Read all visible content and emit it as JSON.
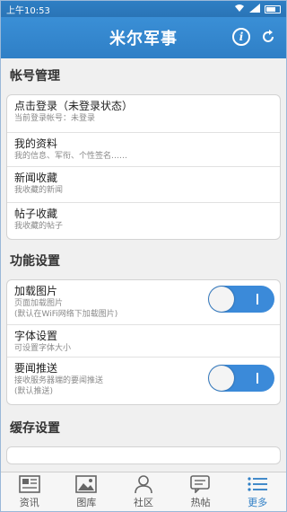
{
  "status_bar": {
    "time": "上午10:53"
  },
  "header": {
    "title": "米尔军事"
  },
  "sections": {
    "account": {
      "title": "帐号管理",
      "items": [
        {
          "title": "点击登录（未登录状态）",
          "subtitle": "当前登录帐号：未登录"
        },
        {
          "title": "我的资料",
          "subtitle": "我的信息、军衔、个性签名……"
        },
        {
          "title": "新闻收藏",
          "subtitle": "我收藏的新闻"
        },
        {
          "title": "帖子收藏",
          "subtitle": "我收藏的帖子"
        }
      ]
    },
    "features": {
      "title": "功能设置",
      "items": [
        {
          "title": "加载图片",
          "subtitle": "页面加载图片",
          "subtitle2": "(默认在WiFi网络下加载图片)",
          "toggle": true
        },
        {
          "title": "字体设置",
          "subtitle": "可设置字体大小"
        },
        {
          "title": "要闻推送",
          "subtitle": "接收服务器端的要闻推送",
          "subtitle2": "(默认推送)",
          "toggle": true
        }
      ]
    },
    "cache": {
      "title": "缓存设置"
    }
  },
  "tabs": [
    {
      "label": "资讯",
      "icon": "news-icon"
    },
    {
      "label": "图库",
      "icon": "gallery-icon"
    },
    {
      "label": "社区",
      "icon": "community-icon"
    },
    {
      "label": "热帖",
      "icon": "hot-posts-icon"
    },
    {
      "label": "更多",
      "icon": "more-icon",
      "active": true
    }
  ],
  "colors": {
    "accent": "#2f7fc6",
    "toggle_on": "#3b8ad9"
  }
}
